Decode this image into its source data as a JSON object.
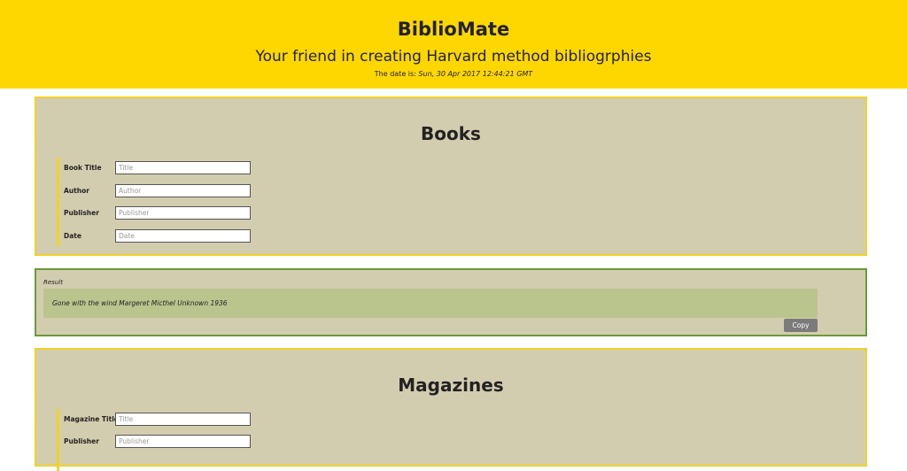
{
  "header": {
    "title": "BiblioMate",
    "subtitle": "Your friend in creating Harvard method bibliogrphies",
    "date_prefix": "The date is: ",
    "date_value": "Sun, 30 Apr 2017 12:44:21 GMT",
    "background_color": "#FFD700"
  },
  "books": {
    "title": "Books",
    "fields": [
      {
        "label": "Book Title",
        "placeholder": "Title"
      },
      {
        "label": "Author",
        "placeholder": "Author"
      },
      {
        "label": "Publisher",
        "placeholder": "Publisher"
      },
      {
        "label": "Date",
        "placeholder": "Date"
      }
    ]
  },
  "result": {
    "label": "Result",
    "text": "Gone with the wind Margeret Micthel Unknown 1936",
    "copy_label": "Copy"
  },
  "magazines": {
    "title": "Magazines",
    "fields": [
      {
        "label": "Magazine Title",
        "placeholder": "Title"
      },
      {
        "label": "Publisher",
        "placeholder": "Publisher"
      }
    ]
  },
  "colors": {
    "panel_background": "#D3CDAF",
    "panel_border": "#F2D22A",
    "result_border": "#6A9A3A",
    "result_box": "#BAC48D",
    "copy_button": "#7B7B7B"
  }
}
